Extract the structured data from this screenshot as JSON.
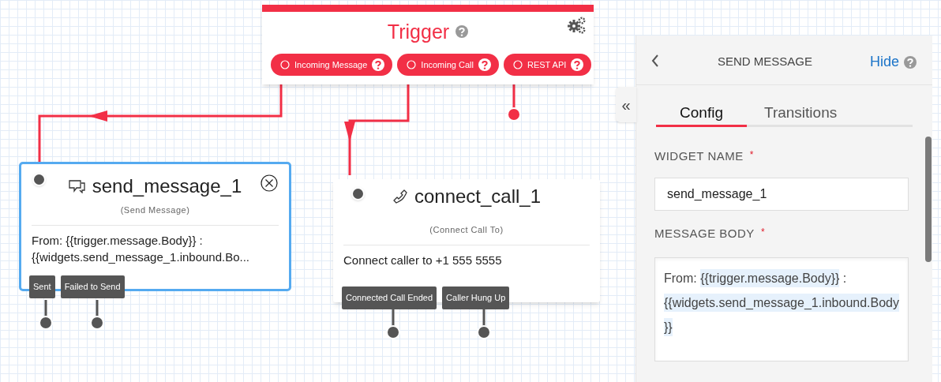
{
  "trigger": {
    "title": "Trigger",
    "outputs": [
      {
        "label": "Incoming Message"
      },
      {
        "label": "Incoming Call"
      },
      {
        "label": "REST API"
      }
    ]
  },
  "widgets": [
    {
      "kind": "send_message",
      "name": "send_message_1",
      "type": "(Send Message)",
      "selected": true,
      "body": "From: {{trigger.message.Body}} :\n{{widgets.send_message_1.inbound.Bo...",
      "transitions": [
        "Sent",
        "Failed to Send"
      ]
    },
    {
      "kind": "connect_call",
      "name": "connect_call_1",
      "type": "(Connect Call To)",
      "selected": false,
      "body": "Connect caller to +1 555 5555",
      "transitions": [
        "Connected Call Ended",
        "Caller Hung Up"
      ]
    }
  ],
  "panel": {
    "title": "SEND MESSAGE",
    "hide": "Hide",
    "collapse": "«",
    "tabs": [
      {
        "label": "Config",
        "selected": true
      },
      {
        "label": "Transitions",
        "selected": false
      }
    ],
    "fields": [
      {
        "kind": "input",
        "label": "WIDGET NAME",
        "required": "*",
        "value": "send_message_1"
      },
      {
        "kind": "textarea",
        "label": "MESSAGE BODY",
        "required": "*",
        "segments": [
          {
            "kind": "text",
            "text": "From: "
          },
          {
            "kind": "variable",
            "text": "{{trigger.message.Body}}"
          },
          {
            "kind": "text",
            "text": " : "
          },
          {
            "kind": "variable",
            "text": "{{widgets.send_message_1.inbound.Body}}"
          }
        ]
      }
    ]
  }
}
